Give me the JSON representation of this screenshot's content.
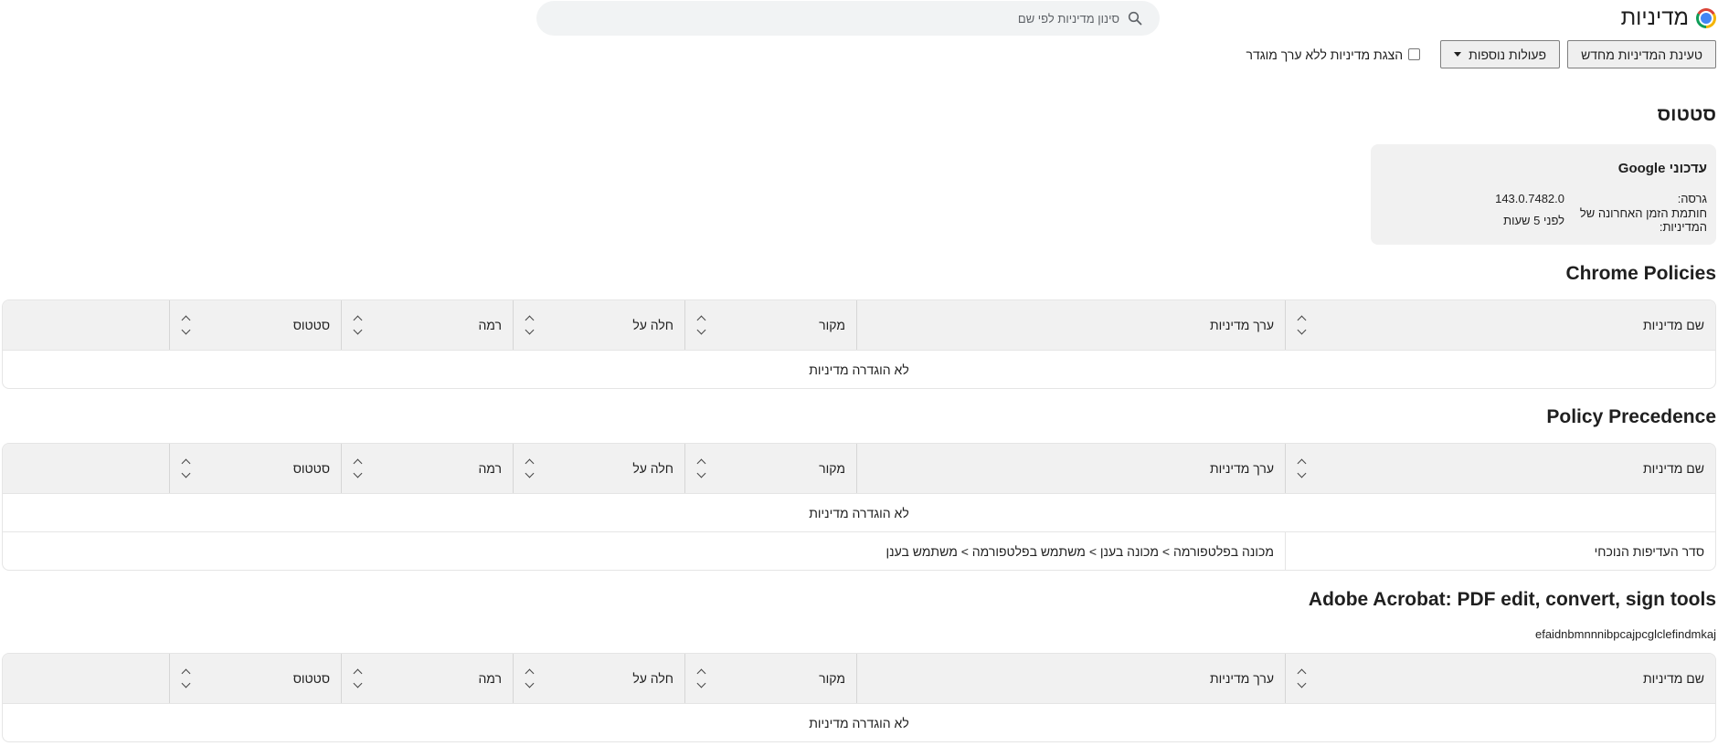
{
  "header": {
    "title": "מדיניות",
    "search_placeholder": "סינון מדיניות לפי שם"
  },
  "toolbar": {
    "reload_label": "טעינת המדיניות מחדש",
    "more_actions_label": "פעולות נוספות",
    "show_unset_label": "הצגת מדיניות ללא ערך מוגדר"
  },
  "status": {
    "heading": "סטטוס",
    "card_title": "עדכוני Google",
    "version_label": "גרסה:",
    "version_value": "143.0.7482.0",
    "timestamp_label": "חותמת הזמן האחרונה של המדיניות:",
    "timestamp_value": "לפני 5 שעות"
  },
  "columns": {
    "name": "שם מדיניות",
    "value": "ערך מדיניות",
    "source": "מקור",
    "applies": "חלה על",
    "level": "רמה",
    "status": "סטטוס"
  },
  "sections": {
    "chrome": {
      "title": "Chrome Policies",
      "empty": "לא הוגדרה מדיניות"
    },
    "precedence": {
      "title": "Policy Precedence",
      "empty": "לא הוגדרה מדיניות",
      "row_name": "סדר העדיפות הנוכחי",
      "row_value": "מכונה בפלטפורמה > מכונה בענן > משתמש בפלטפורמה > משתמש בענן"
    },
    "acrobat": {
      "title": "Adobe Acrobat: PDF edit, convert, sign tools",
      "extension_id": "efaidnbmnnnibpcajpcglclefindmkaj",
      "empty": "לא הוגדרה מדיניות"
    }
  },
  "icons": {
    "logo": "chrome-logo",
    "search": "search-icon",
    "dropdown": "caret-down-icon",
    "sort": "sort-icon"
  }
}
